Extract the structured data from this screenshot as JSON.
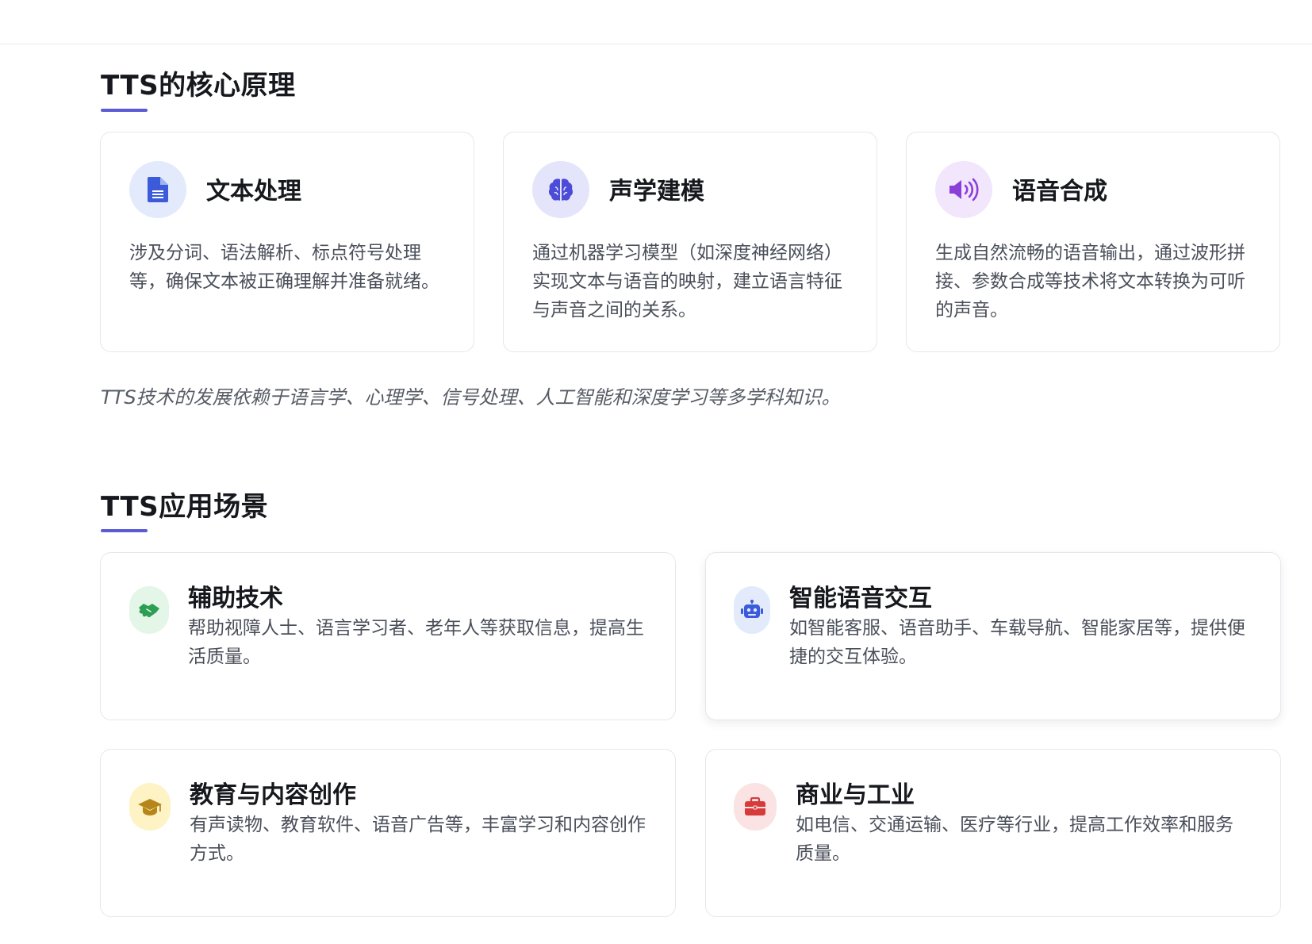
{
  "principles": {
    "title": "TTS的核心原理",
    "cards": [
      {
        "title": "文本处理",
        "desc": "涉及分词、语法解析、标点符号处理等，确保文本被正确理解并准备就绪。",
        "icon": "document-icon",
        "icon_color": "#3b5bdb",
        "icon_bg": "#e3eafc"
      },
      {
        "title": "声学建模",
        "desc": "通过机器学习模型（如深度神经网络）实现文本与语音的映射，建立语言特征与声音之间的关系。",
        "icon": "brain-icon",
        "icon_color": "#4c4cd8",
        "icon_bg": "#e4e4fb"
      },
      {
        "title": "语音合成",
        "desc": "生成自然流畅的语音输出，通过波形拼接、参数合成等技术将文本转换为可听的声音。",
        "icon": "speaker-icon",
        "icon_color": "#8b3fd9",
        "icon_bg": "#f1e6fb"
      }
    ],
    "note": "TTS技术的发展依赖于语言学、心理学、信号处理、人工智能和深度学习等多学科知识。"
  },
  "applications": {
    "title": "TTS应用场景",
    "cards": [
      {
        "title": "辅助技术",
        "desc": "帮助视障人士、语言学习者、老年人等获取信息，提高生活质量。",
        "icon": "handshake-icon",
        "icon_color": "#2f9e55",
        "icon_bg": "#e3f6e8"
      },
      {
        "title": "智能语音交互",
        "desc": "如智能客服、语音助手、车载导航、智能家居等，提供便捷的交互体验。",
        "icon": "robot-icon",
        "icon_color": "#3b5bdb",
        "icon_bg": "#e3eafc"
      },
      {
        "title": "教育与内容创作",
        "desc": "有声读物、教育软件、语音广告等，丰富学习和内容创作方式。",
        "icon": "graduation-cap-icon",
        "icon_color": "#b7861a",
        "icon_bg": "#fdf3c4"
      },
      {
        "title": "商业与工业",
        "desc": "如电信、交通运输、医疗等行业，提高工作效率和服务质量。",
        "icon": "briefcase-icon",
        "icon_color": "#d63a3a",
        "icon_bg": "#fbe3e3"
      }
    ]
  }
}
